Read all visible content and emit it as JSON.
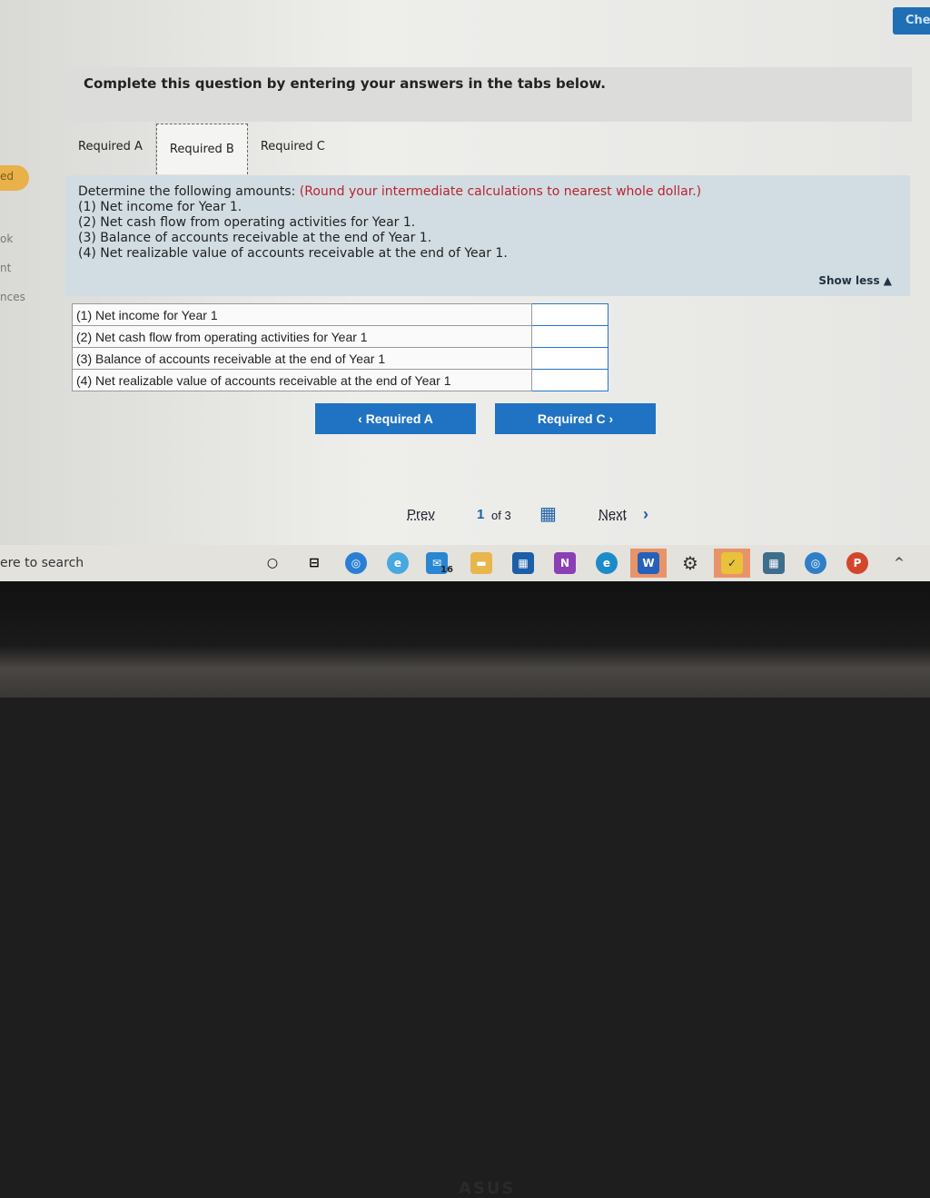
{
  "check_button": "Che",
  "sidebar_fragments": [
    "ed",
    "ok",
    "nt",
    "nces"
  ],
  "header": {
    "title": "Complete this question by entering your answers in the tabs below."
  },
  "tabs": [
    {
      "label": "Required A"
    },
    {
      "label": "Required B",
      "active": true
    },
    {
      "label": "Required C"
    }
  ],
  "prompt": {
    "intro": "Determine the following amounts:",
    "note": "(Round your intermediate calculations to nearest whole dollar.)",
    "items": [
      "(1) Net income for Year 1.",
      "(2) Net cash flow from operating activities for Year 1.",
      "(3) Balance of accounts receivable at the end of Year 1.",
      "(4) Net realizable value of accounts receivable at the end of Year 1."
    ],
    "show_less": "Show less ▲"
  },
  "answer_table": {
    "rows": [
      {
        "label": "(1) Net income for Year 1",
        "value": ""
      },
      {
        "label": "(2) Net cash flow from operating activities for Year 1",
        "value": ""
      },
      {
        "label": "(3) Balance of accounts receivable at the end of Year 1",
        "value": ""
      },
      {
        "label": "(4) Net realizable value of accounts receivable at the end of Year 1",
        "value": ""
      }
    ]
  },
  "nav": {
    "prev_tab": "‹  Required A",
    "next_tab": "Required C  ›"
  },
  "pager": {
    "prev": "Prev",
    "current": "1",
    "of": "of 3",
    "next": "Next"
  },
  "taskbar": {
    "search_placeholder": "ere to search",
    "mail_badge": "16"
  },
  "bezel_logo": "ASUS",
  "colors": {
    "accent": "#1f73c2",
    "note_red": "#b8242e",
    "prompt_bg": "#d2dde3"
  }
}
